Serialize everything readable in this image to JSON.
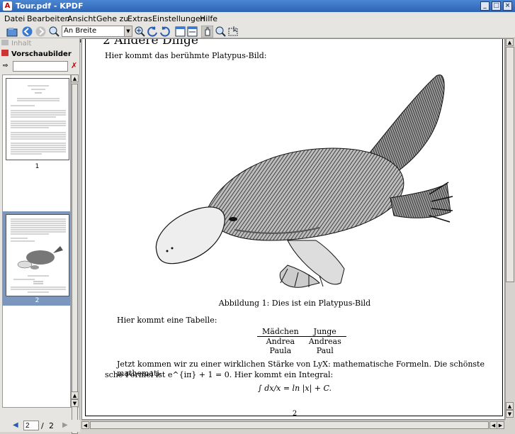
{
  "window": {
    "title": "Tour.pdf - KPDF",
    "controls": [
      "_",
      "□",
      "×"
    ]
  },
  "menu": [
    "Datei",
    "Bearbeiten",
    "Ansicht",
    "Gehe zu",
    "Extras",
    "Einstellungen",
    "Hilfe"
  ],
  "toolbar": {
    "zoom_value": "An Breite anpassen"
  },
  "sidebar": {
    "tab_contents": "Inhalt",
    "tab_thumbnails": "Vorschaubilder",
    "filter_placeholder": "",
    "thumbnails": [
      {
        "page": "1"
      },
      {
        "page": "2"
      }
    ],
    "page_current": "2",
    "page_sep": "/",
    "page_total": "2"
  },
  "document": {
    "heading": "2   Andere Dinge",
    "intro": "Hier kommt das berühmte Platypus-Bild:",
    "caption": "Abbildung 1: Dies ist ein Platypus-Bild",
    "table_intro": "Hier kommt eine Tabelle:",
    "table": {
      "headers": [
        "Mädchen",
        "Junge"
      ],
      "rows": [
        [
          "Andrea",
          "Andreas"
        ],
        [
          "Paula",
          "Paul"
        ]
      ]
    },
    "para_line1": "Jetzt kommen wir zu einer wirklichen Stärke von LyX: mathematische Formeln. Die schönste mathemati-",
    "para_line2": "sche Formel ist e^{iπ} + 1 = 0. Hier kommt ein Integral:",
    "integral": "∫ dx/x = ln |x| + C.",
    "page_number": "2"
  },
  "colors": {
    "titlebar": "#2f64b5",
    "selection": "#7b97be"
  }
}
